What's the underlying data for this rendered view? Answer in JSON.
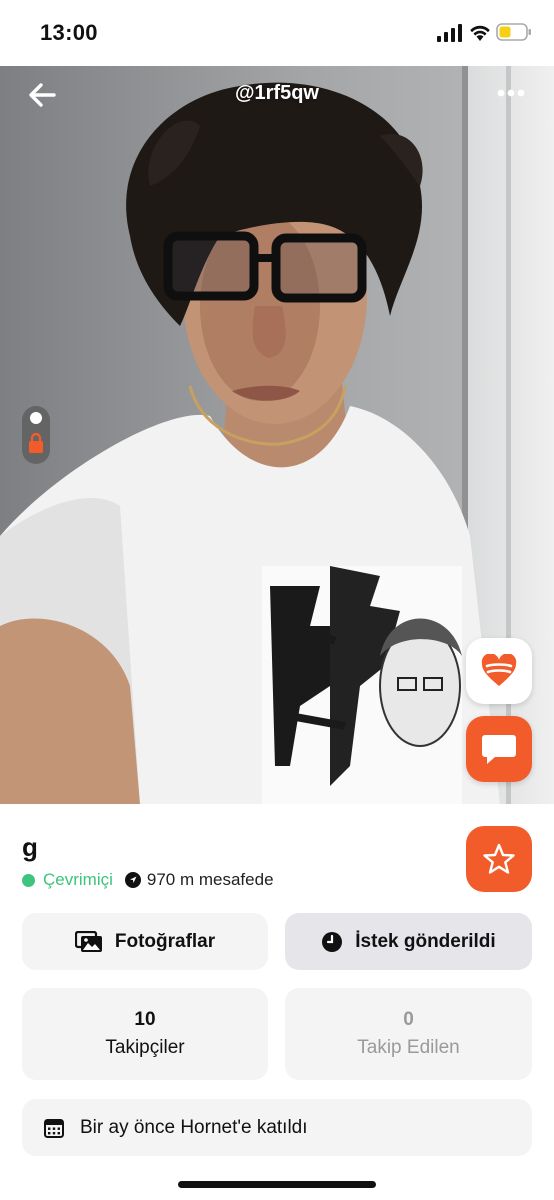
{
  "status_bar": {
    "time": "13:00"
  },
  "header": {
    "username": "@1rf5qw"
  },
  "profile": {
    "name": "g",
    "online_status": "Çevrimiçi",
    "distance": "970 m mesafede"
  },
  "buttons": {
    "photos": "Fotoğraflar",
    "request": "İstek gönderildi"
  },
  "stats": {
    "followers": {
      "count": "10",
      "label": "Takipçiler"
    },
    "following": {
      "count": "0",
      "label": "Takip Edilen"
    }
  },
  "joined": "Bir ay önce Hornet'e katıldı",
  "colors": {
    "accent": "#f25c2b",
    "online": "#3ec47c"
  }
}
